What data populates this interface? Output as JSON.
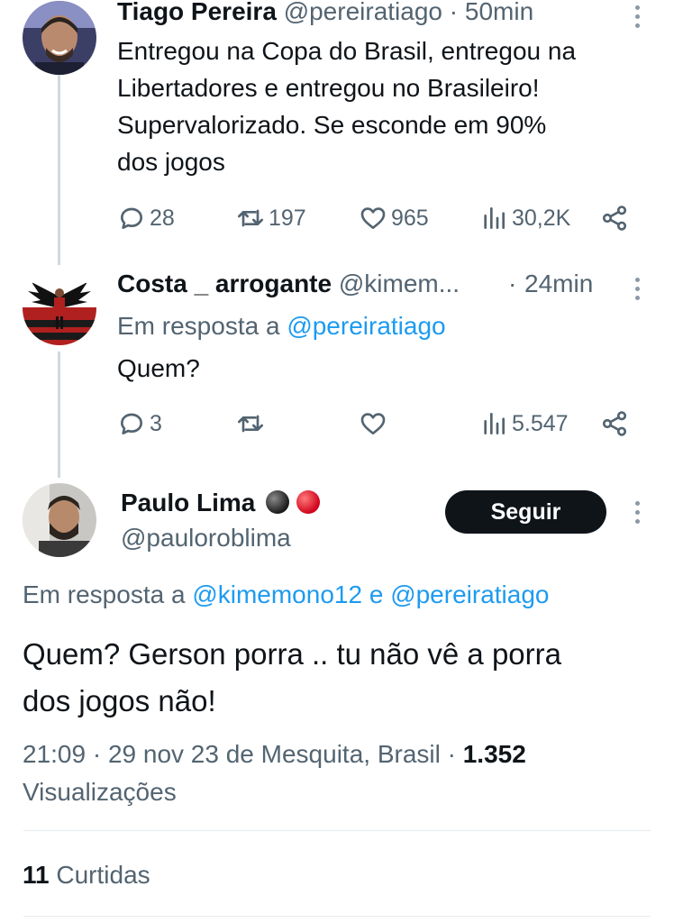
{
  "tweets": [
    {
      "author": "Tiago Pereira",
      "handle": "@pereiratiago",
      "sep": "·",
      "time": "50min",
      "text": "Entregou na Copa do Brasil, entregou na\nLibertadores e entregou no Brasileiro!\nSupervalorizado. Se esconde em 90%\ndos jogos",
      "replies": "28",
      "retweets": "197",
      "likes": "965",
      "views": "30,2K"
    },
    {
      "author": "Costa _ arrogante",
      "handle": "@kimem...",
      "sep": "·",
      "time": "24min",
      "reply_prefix": "Em resposta a",
      "reply_to": "@pereiratiago",
      "text": "Quem?",
      "replies": "3",
      "retweets": "",
      "likes": "",
      "views": "5.547"
    }
  ],
  "main_tweet": {
    "author": "Paulo Lima",
    "handle": "@pauloroblima",
    "follow_label": "Seguir",
    "reply_prefix": "Em resposta a",
    "reply_to_1": "@kimemono12",
    "reply_and": "e",
    "reply_to_2": "@pereiratiago",
    "text": "Quem? Gerson porra .. tu não vê a porra\ndos jogos não!",
    "timestamp": "21:09 · 29 nov 23 de Mesquita, Brasil ·",
    "views_count": "1.352",
    "views_label": "Visualizações",
    "likes_count": "11",
    "likes_label": "Curtidas"
  },
  "colors": {
    "link": "#1d9bf0",
    "muted": "#536471",
    "thread_line": "#cfd9de",
    "follow_button": "#0f1419"
  }
}
